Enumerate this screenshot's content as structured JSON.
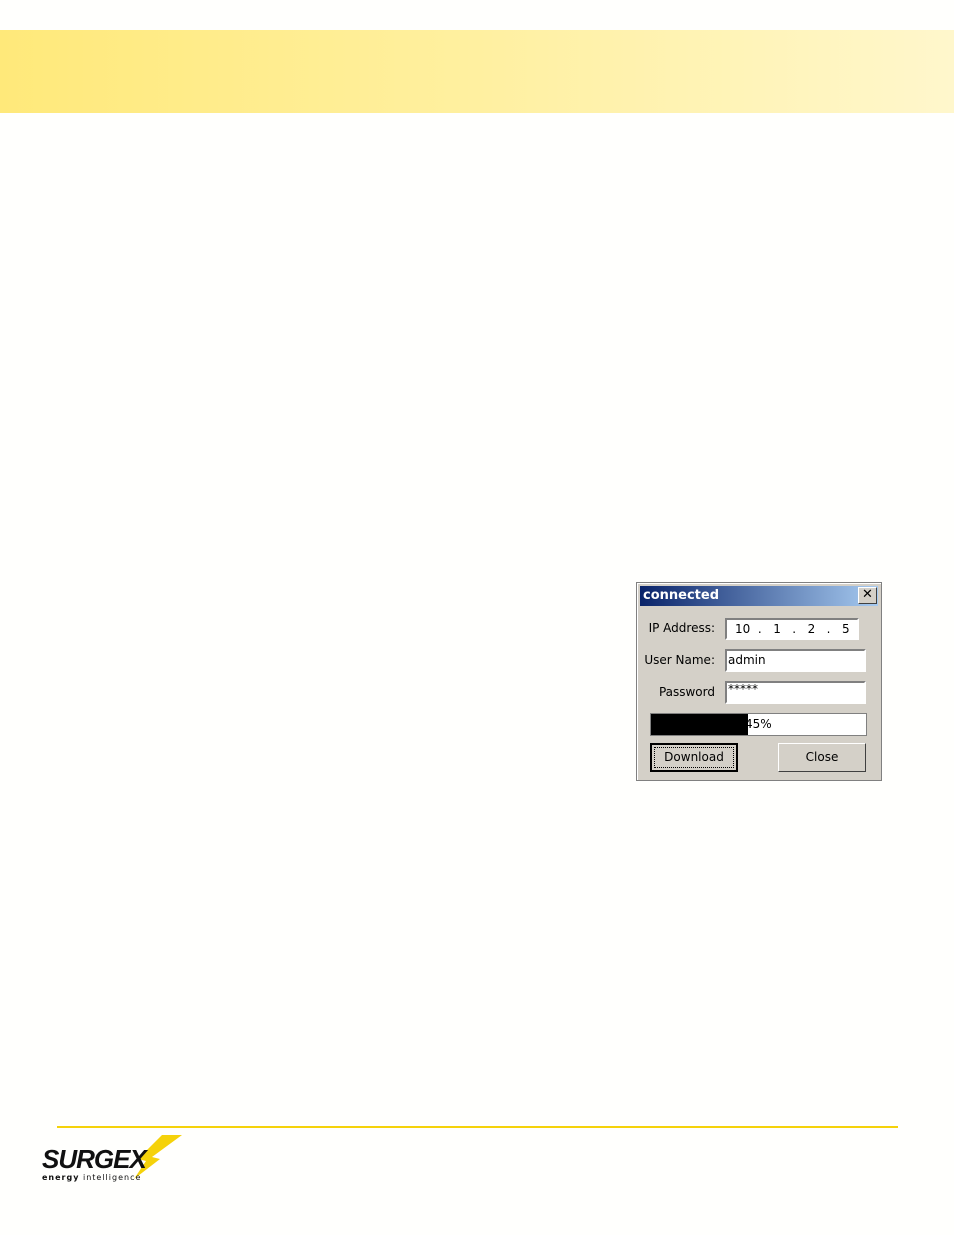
{
  "dialog": {
    "title": "connected",
    "close_x": "✕",
    "ip_label": "IP Address:",
    "ip": [
      "10",
      ".",
      "1",
      ".",
      "2",
      ".",
      "5"
    ],
    "user_label": "User Name:",
    "user_value": "admin",
    "password_label": "Password",
    "password_value": "*****",
    "progress_percent": 45,
    "progress_text": "45%",
    "download_label": "Download",
    "close_label": "Close"
  },
  "footer": {
    "logo_text": "SURGEX",
    "tagline": "energy intelligence",
    "accent": "#f5d20a"
  }
}
